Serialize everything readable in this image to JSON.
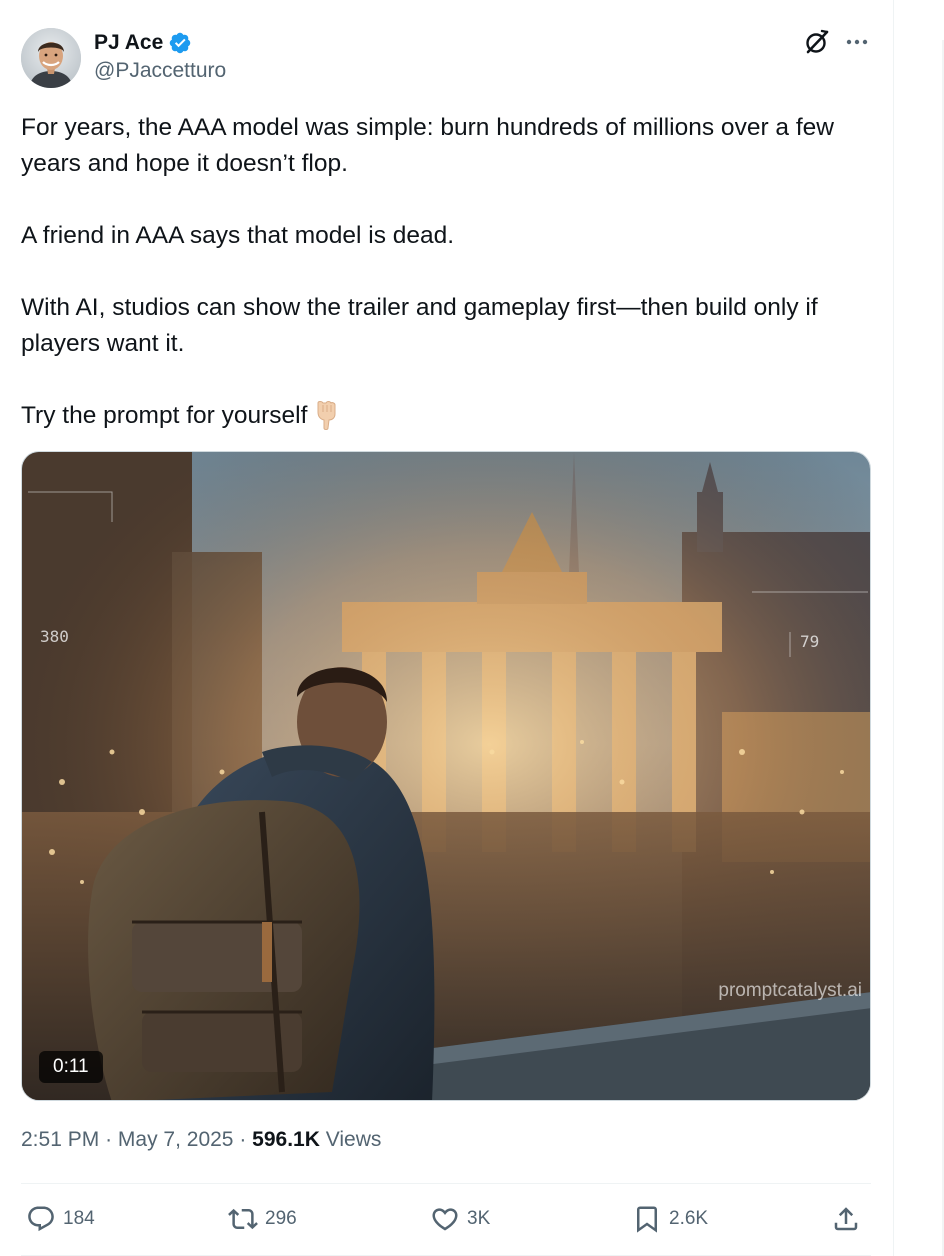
{
  "author": {
    "name": "PJ Ace",
    "handle": "@PJaccetturo",
    "verified": true,
    "verified_color": "#1d9bf0",
    "avatar_icon": "avatar-photo"
  },
  "header_actions": {
    "grok_icon": "grok-icon",
    "more_icon": "more-icon"
  },
  "tweet": {
    "paragraphs": [
      "For years, the AAA model was simple: burn hundreds of millions over a few years and hope it doesn’t flop.",
      "A friend in AAA says that model is dead.",
      "With AI, studios can show the trailer and gameplay first—then build only if players want it.",
      "Try the prompt for yourself"
    ],
    "emoji": "pointing-down-emoji"
  },
  "media": {
    "type": "video",
    "duration": "0:11",
    "watermark": "promptcatalyst.ai",
    "hud_left": "380",
    "hud_right": "79"
  },
  "meta": {
    "time": "2:51 PM",
    "separator": "·",
    "date": "May 7, 2025",
    "views_count": "596.1K",
    "views_label": "Views"
  },
  "actions": {
    "replies": "184",
    "reposts": "296",
    "likes": "3K",
    "bookmarks": "2.6K"
  },
  "colors": {
    "text_primary": "#0f1419",
    "text_secondary": "#536471",
    "border": "#eff3f4"
  }
}
